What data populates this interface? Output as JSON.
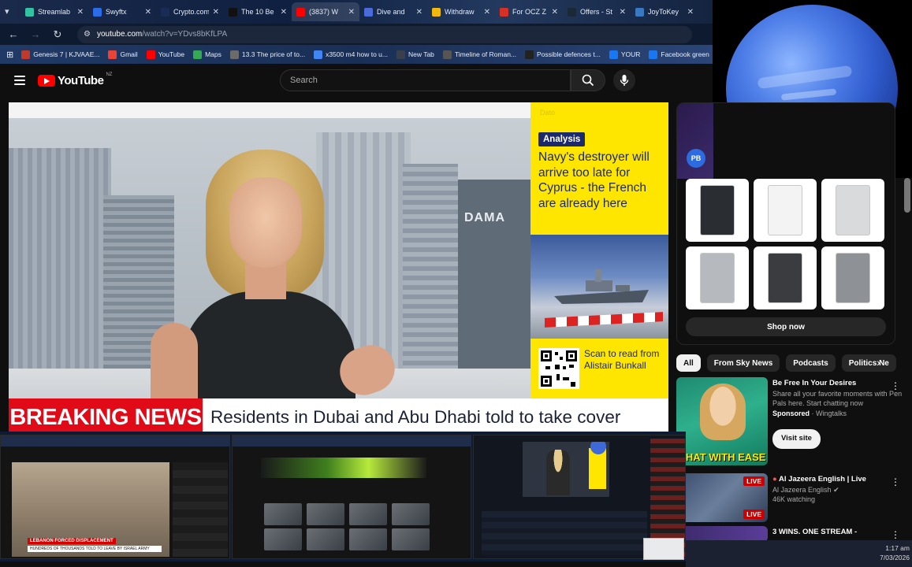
{
  "browser": {
    "tabs": [
      {
        "label": "Streamlab",
        "icon": "streamlabs-icon",
        "color": "#31c3a2"
      },
      {
        "label": "Swyftx",
        "icon": "swyftx-icon",
        "color": "#2b6de8"
      },
      {
        "label": "Crypto.com",
        "icon": "crypto-icon",
        "color": "#1a2c54"
      },
      {
        "label": "The 10 Be",
        "icon": "threads-icon",
        "color": "#111111"
      },
      {
        "label": "(3837) W",
        "icon": "youtube-icon",
        "color": "#ff0000"
      },
      {
        "label": "Dive and",
        "icon": "globe-icon",
        "color": "#4a6cd8"
      },
      {
        "label": "Withdraw",
        "icon": "binance-icon",
        "color": "#f0b90b"
      },
      {
        "label": "For OCZ Z",
        "icon": "mail-icon",
        "color": "#d93025"
      },
      {
        "label": "Offers - St",
        "icon": "steam-icon",
        "color": "#1b2838"
      },
      {
        "label": "JoyToKey",
        "icon": "joytokey-icon",
        "color": "#3a78c2"
      }
    ],
    "address": {
      "host": "youtube.com",
      "path": "/watch?v=YDvs8bKfLPA"
    },
    "bookmarks": [
      {
        "label": "Genesis 7 | KJVAAE...",
        "color": "#c0392b"
      },
      {
        "label": "Gmail",
        "color": "#ea4335"
      },
      {
        "label": "YouTube",
        "color": "#ff0000"
      },
      {
        "label": "Maps",
        "color": "#34a853"
      },
      {
        "label": "13.3 The price of to...",
        "color": "#6b6b6b"
      },
      {
        "label": "x3500 m4 how to u...",
        "color": "#4285f4"
      },
      {
        "label": "New Tab",
        "color": "#3a3f4b"
      },
      {
        "label": "Timeline of Roman...",
        "color": "#555555"
      },
      {
        "label": "Possible defences t...",
        "color": "#222222"
      },
      {
        "label": "YOUR",
        "color": "#1877f2"
      },
      {
        "label": "Facebook green",
        "color": "#1877f2"
      }
    ]
  },
  "youtube": {
    "logo_word": "YouTube",
    "country": "NZ",
    "search_placeholder": "Search"
  },
  "video": {
    "building_sign": "DAMA",
    "panel_faint": "Dato",
    "analysis_tag": "Analysis",
    "headline": "Navy's destroyer will arrive too late for Cyprus - the French are already here",
    "qr_text": "Scan to read from Alistair Bunkall",
    "breaking": "BREAKING NEWS",
    "ticker": "Residents in Dubai and Abu Dhabi told to take cover"
  },
  "ad": {
    "logo": "PB",
    "shop_now": "Shop now",
    "products": [
      {
        "color": "#2a2d31"
      },
      {
        "color": "#f3f3f3"
      },
      {
        "color": "#d9dadb"
      },
      {
        "color": "#b6b9bd"
      },
      {
        "color": "#3a3c40"
      },
      {
        "color": "#8e9297"
      }
    ]
  },
  "chips": [
    "All",
    "From Sky News",
    "Podcasts",
    "Politics Ne"
  ],
  "recommendations": [
    {
      "title": "Be Free In Your Desires",
      "line1": "Share all your favorite moments with Pen Pals here. Start chatting now",
      "sponsored": "Sponsored",
      "channel": "Wingtalks",
      "cta": "Visit site",
      "overlay": "CHAT WITH EASE"
    },
    {
      "title": "Al Jazeera English | Live",
      "channel": "Al Jazeera English",
      "stats": "46K watching",
      "live": "LIVE"
    },
    {
      "title": "3 WINS. ONE STREAM -"
    }
  ],
  "task_previews": {
    "p1_caption": "LEBANON FORCED DISPLACEMENT",
    "p1_sub": "HUNDREDS OF THOUSANDS TOLD TO LEAVE BY ISRAEL ARMY"
  },
  "clock": {
    "time": "1:17 am",
    "date": "7/03/2026"
  }
}
